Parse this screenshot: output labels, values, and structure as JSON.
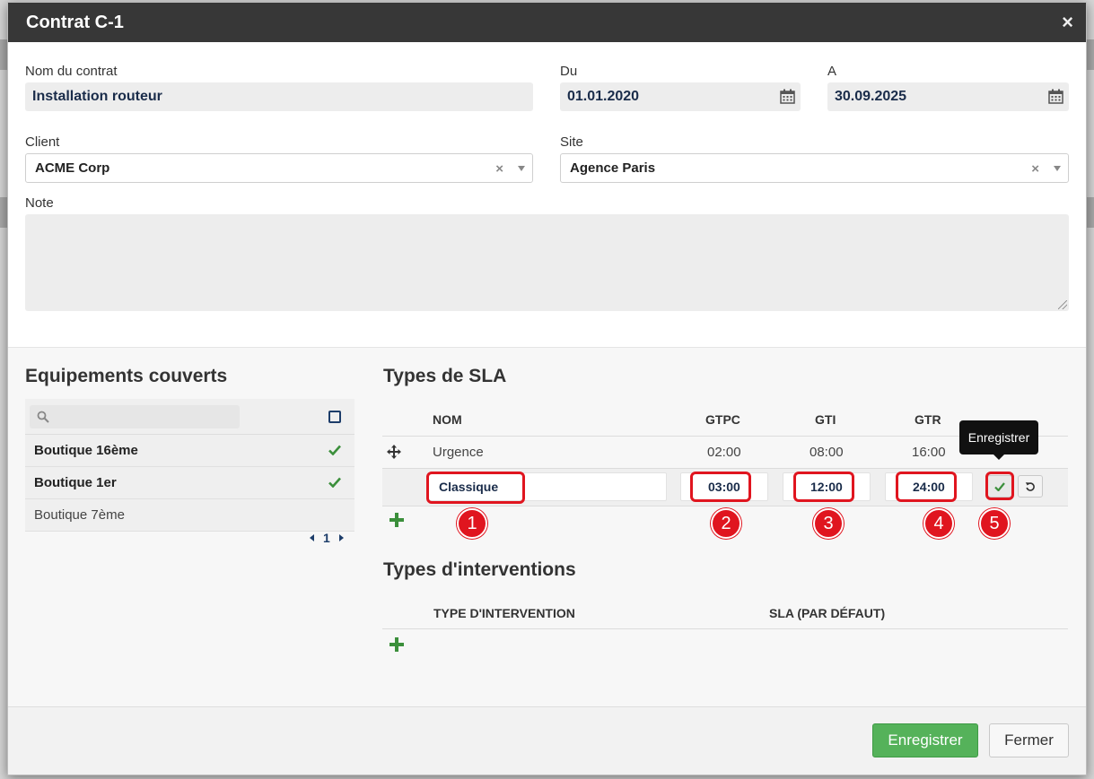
{
  "modal": {
    "title": "Contrat C-1",
    "close_label": "×"
  },
  "form": {
    "name_label": "Nom du contrat",
    "name_value": "Installation routeur",
    "from_label": "Du",
    "from_value": "01.01.2020",
    "to_label": "A",
    "to_value": "30.09.2025",
    "client_label": "Client",
    "client_value": "ACME Corp",
    "site_label": "Site",
    "site_value": "Agence Paris",
    "note_label": "Note",
    "clear_label": "×"
  },
  "equipment": {
    "title": "Equipements couverts",
    "search_placeholder": "",
    "items": [
      {
        "label": "Boutique 16ème",
        "checked": true
      },
      {
        "label": "Boutique 1er",
        "checked": true
      },
      {
        "label": "Boutique 7ème",
        "checked": false
      }
    ],
    "page": "1"
  },
  "sla": {
    "title": "Types de SLA",
    "headers": {
      "nom": "NOM",
      "gtpc": "GTPC",
      "gti": "GTI",
      "gtr": "GTR"
    },
    "rows": [
      {
        "nom": "Urgence",
        "gtpc": "02:00",
        "gti": "08:00",
        "gtr": "16:00"
      }
    ],
    "edit_row": {
      "nom": "Classique",
      "gtpc": "03:00",
      "gti": "12:00",
      "gtr": "24:00"
    },
    "tooltip": "Enregistrer",
    "badges": [
      "1",
      "2",
      "3",
      "4",
      "5"
    ],
    "highlight_color": "#e0151f"
  },
  "interventions": {
    "title": "Types d'interventions",
    "headers": {
      "type": "TYPE D'INTERVENTION",
      "sla": "SLA (PAR DÉFAUT)"
    }
  },
  "footer": {
    "save_label": "Enregistrer",
    "close_label": "Fermer"
  },
  "colors": {
    "header_bg": "#373737",
    "primary": "#55b25a",
    "check": "#3b8f3b",
    "accent": "#1d3d6a"
  }
}
